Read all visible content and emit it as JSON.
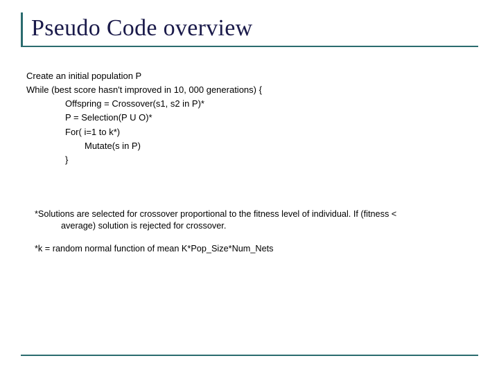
{
  "title": "Pseudo Code overview",
  "code": {
    "l1": "Create an initial population P",
    "l2": "While (best score hasn't improved in 10, 000 generations) {",
    "l3": "Offspring = Crossover(s1, s2 in P)*",
    "l4": "P = Selection(P U O)*",
    "l5": "For( i=1 to k*)",
    "l6": "Mutate(s in P)",
    "l7": "}"
  },
  "footnotes": {
    "f1a": "*Solutions are selected for crossover proportional to the fitness level of individual.  If (fitness <",
    "f1b": "average) solution is rejected for crossover.",
    "f2": "*k = random normal function of mean K*Pop_Size*Num_Nets"
  }
}
